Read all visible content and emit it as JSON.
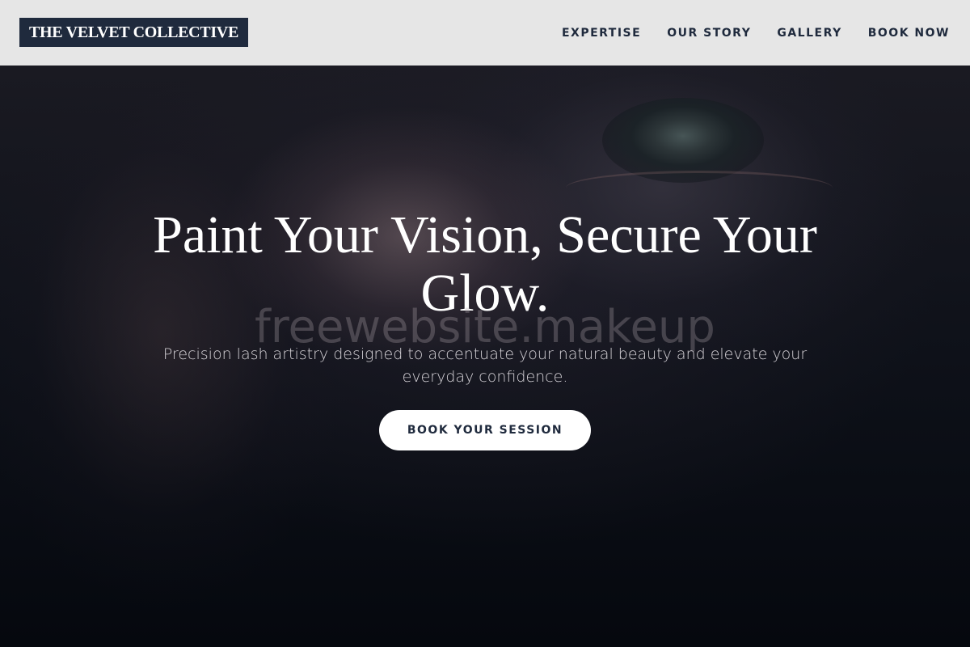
{
  "header": {
    "logo_text": "THE VELVET COLLECTIVE",
    "nav": [
      {
        "label": "EXPERTISE"
      },
      {
        "label": "OUR STORY"
      },
      {
        "label": "GALLERY"
      },
      {
        "label": "BOOK NOW"
      }
    ]
  },
  "hero": {
    "headline": "Paint Your Vision, Secure Your Glow.",
    "subtitle": "Precision lash artistry designed to accentuate your natural beauty and elevate your everyday confidence.",
    "cta_label": "BOOK YOUR SESSION",
    "watermark": "freewebsite.makeup"
  },
  "colors": {
    "header_bg": "#e6e6e6",
    "logo_bg": "#1f2a3d",
    "nav_text": "#1f2a3d",
    "hero_bg": "#0a0d14",
    "cta_bg": "#ffffff"
  }
}
